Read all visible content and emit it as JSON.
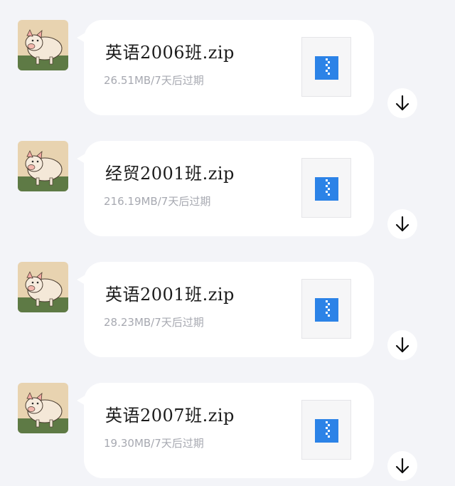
{
  "messages": [
    {
      "file_name": "英语2006班.zip",
      "file_meta": "26.51MB/7天后过期",
      "file_type_icon": "zip-archive-icon",
      "download_icon": "download-arrow-icon"
    },
    {
      "file_name": "经贸2001班.zip",
      "file_meta": "216.19MB/7天后过期",
      "file_type_icon": "zip-archive-icon",
      "download_icon": "download-arrow-icon"
    },
    {
      "file_name": "英语2001班.zip",
      "file_meta": "28.23MB/7天后过期",
      "file_type_icon": "zip-archive-icon",
      "download_icon": "download-arrow-icon"
    },
    {
      "file_name": "英语2007班.zip",
      "file_meta": "19.30MB/7天后过期",
      "file_type_icon": "zip-archive-icon",
      "download_icon": "download-arrow-icon"
    }
  ],
  "colors": {
    "background": "#f3f4f8",
    "bubble": "#ffffff",
    "zip_icon": "#2c83e7",
    "meta_text": "#a7a9b1"
  }
}
